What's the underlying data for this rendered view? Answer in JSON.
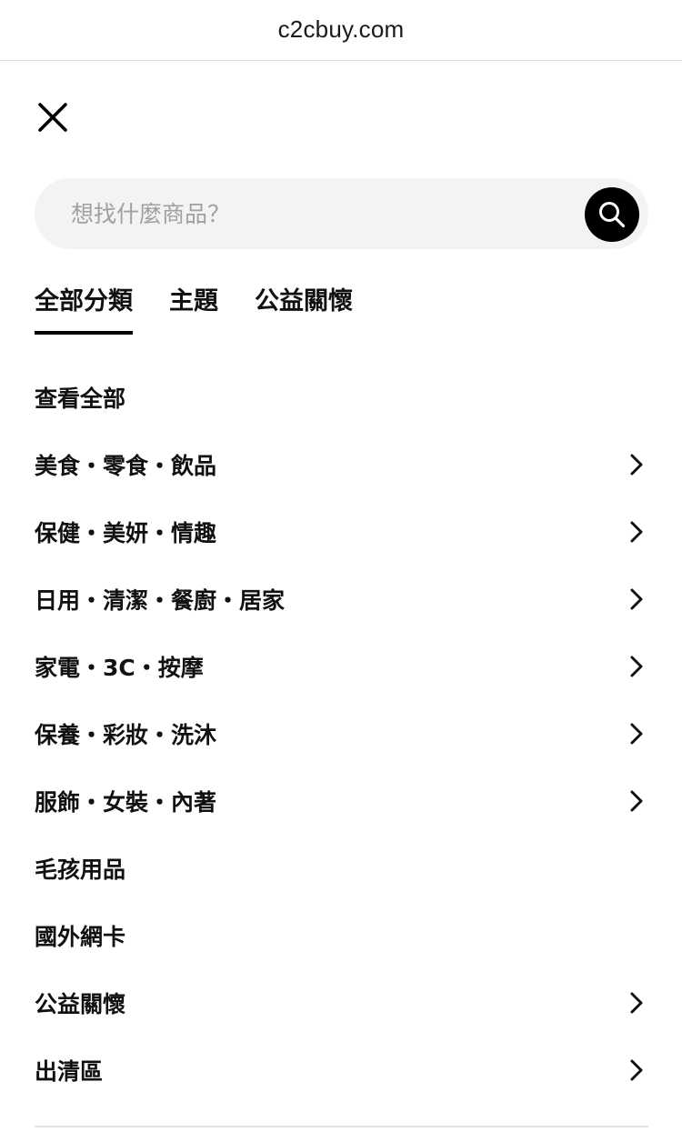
{
  "browser": {
    "url": "c2cbuy.com"
  },
  "icons": {
    "close": "close-icon",
    "search": "search-icon",
    "chevron": "chevron-right-icon"
  },
  "colors": {
    "search_button": "#000000",
    "search_box_bg": "#f3f3f3",
    "placeholder": "#a0a0a0",
    "active_underline": "#000000"
  },
  "search": {
    "placeholder": "想找什麼商品？"
  },
  "tabs": [
    {
      "label": "全部分類",
      "active": true
    },
    {
      "label": "主題",
      "active": false
    },
    {
      "label": "公益關懷",
      "active": false
    }
  ],
  "categories": [
    {
      "label": "查看全部",
      "has_chevron": false
    },
    {
      "label": "美食・零食・飲品",
      "has_chevron": true
    },
    {
      "label": "保健・美妍・情趣",
      "has_chevron": true
    },
    {
      "label": "日用・清潔・餐廚・居家",
      "has_chevron": true
    },
    {
      "label": "家電・3C・按摩",
      "has_chevron": true
    },
    {
      "label": "保養・彩妝・洗沐",
      "has_chevron": true
    },
    {
      "label": "服飾・女裝・內著",
      "has_chevron": true
    },
    {
      "label": "毛孩用品",
      "has_chevron": false
    },
    {
      "label": "國外網卡",
      "has_chevron": false
    },
    {
      "label": "公益關懷",
      "has_chevron": true
    },
    {
      "label": "出清區",
      "has_chevron": true
    }
  ]
}
